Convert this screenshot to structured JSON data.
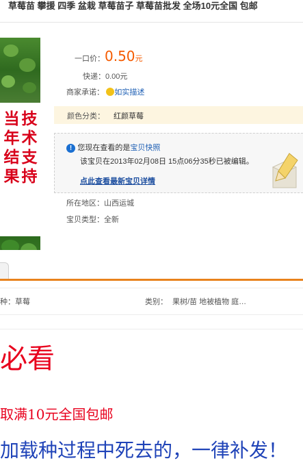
{
  "title": "草莓苗 攀援 四季 盆栽 草莓苗子 草莓苗批发 全场10元全国 包邮",
  "image": {
    "slogan_left": [
      "当",
      "年",
      "结",
      "果"
    ],
    "slogan_right": [
      "技",
      "术",
      "支",
      "持"
    ]
  },
  "price": {
    "label": "一口价：",
    "value": "0.50",
    "unit": "元"
  },
  "shipping": {
    "label": "快递：",
    "value": "0.00元"
  },
  "promise": {
    "label": "商家承诺：",
    "link": "如实描述"
  },
  "color": {
    "label": "颜色分类：",
    "value": "红颜草莓"
  },
  "snapshot": {
    "line1_prefix": "您现在查看的是",
    "line1_link": "宝贝快照",
    "line2": "该宝贝在2013年02月08日 15点06分35秒已被编辑。",
    "link_latest": "点此查看最新宝贝详情"
  },
  "location": {
    "label": "所在地区：",
    "value": "山西运城"
  },
  "item_type": {
    "label": "宝贝类型：",
    "value": "全新"
  },
  "attributes": [
    {
      "label": "种：",
      "value": "草莓"
    },
    {
      "label": "类别：",
      "value": "果树/苗 地被植物 庭…"
    }
  ],
  "desc": {
    "line1": "必看",
    "line2": "取满10元全国包邮",
    "line3": "加载种过程中死去的，一律补发！"
  },
  "colors": {
    "price": "#f55b00",
    "accent": "#e8821c",
    "link": "#1e5fb4",
    "red": "#e8001d",
    "blue": "#1f43b8"
  }
}
